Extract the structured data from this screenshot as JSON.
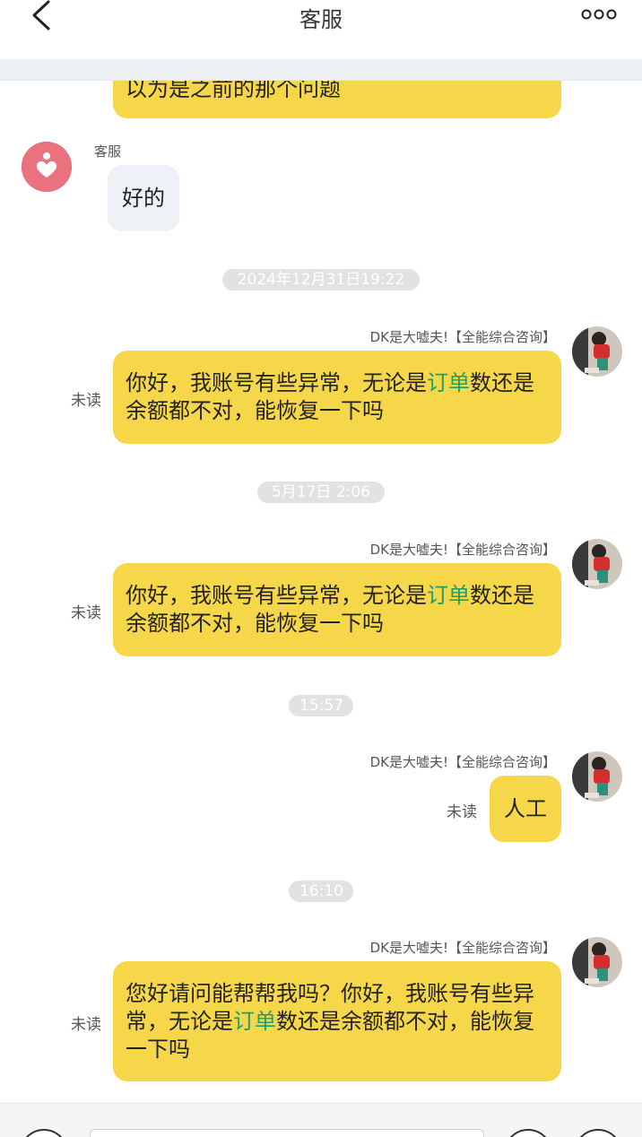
{
  "header": {
    "title": "客服",
    "back_icon": "chevron-left-icon",
    "more_icon": "more-dots-icon"
  },
  "messages": {
    "m0": {
      "text": "以为是之前的那个问题"
    },
    "m1": {
      "sender": "客服",
      "text": "好的"
    },
    "t1": "2024年12月31日19:22",
    "m2": {
      "sender": "DK是大嘘夫!【全能综合咨询】",
      "status": "未读",
      "text_before": "你好，我账号有些异常，无论是",
      "text_highlight": "订单",
      "text_after": "数还是余额都不对，能恢复一下吗"
    },
    "t2": "5月17日 2:06",
    "m3": {
      "sender": "DK是大嘘夫!【全能综合咨询】",
      "status": "未读",
      "text_before": "你好，我账号有些异常，无论是",
      "text_highlight": "订单",
      "text_after": "数还是余额都不对，能恢复一下吗"
    },
    "t3": "15:57",
    "m4": {
      "sender": "DK是大嘘夫!【全能综合咨询】",
      "status": "未读",
      "text": "人工"
    },
    "t4": "16:10",
    "m5": {
      "sender": "DK是大嘘夫!【全能综合咨询】",
      "status": "未读",
      "text_before": "您好请问能帮帮我吗？你好，我账号有些异常，无论是",
      "text_highlight": "订单",
      "text_after": "数还是余额都不对，能恢复一下吗"
    }
  },
  "colors": {
    "outgoing_bubble": "#f6d74a",
    "incoming_bubble": "#eef1f5",
    "highlight_text": "#1aa06b",
    "timestamp_pill": "#e2e2e2"
  },
  "footer": {
    "left_button_icon": "voice-icon",
    "right_button_icons": [
      "emoji-icon",
      "add-icon"
    ]
  }
}
